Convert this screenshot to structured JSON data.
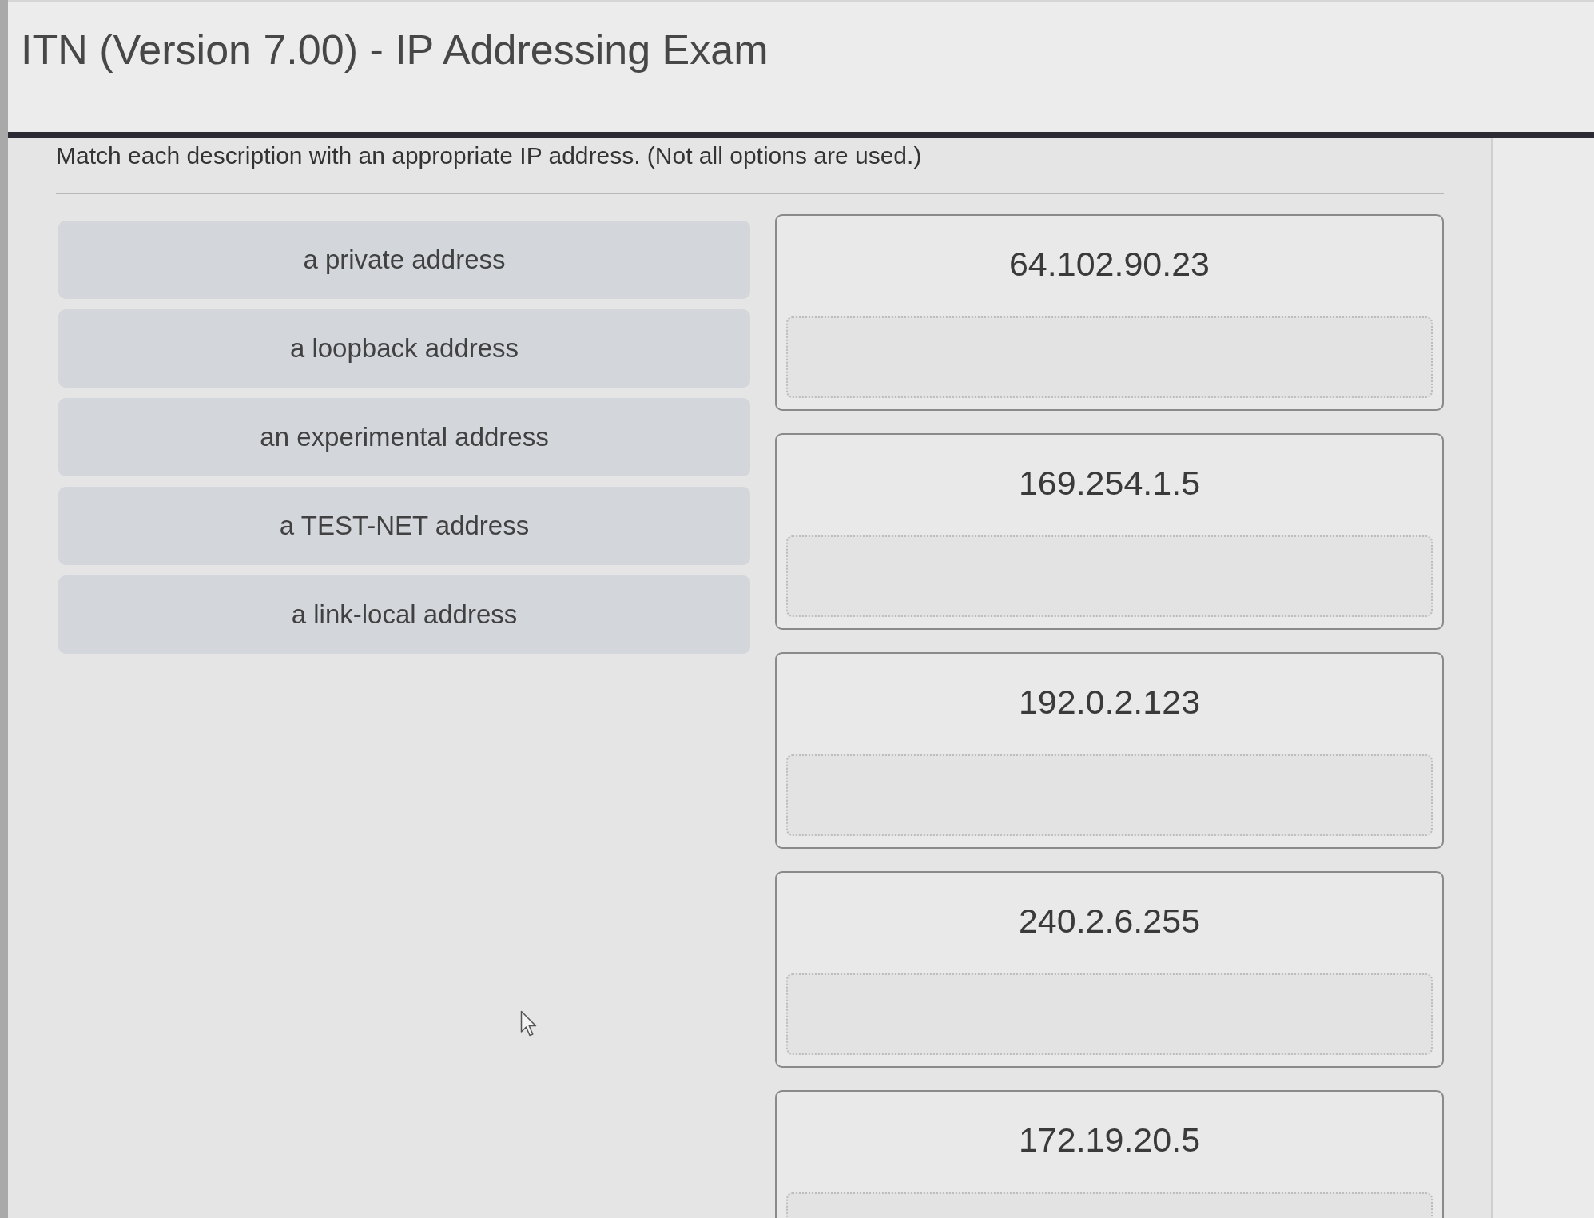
{
  "title": "ITN (Version 7.00) - IP Addressing Exam",
  "question": {
    "instruction": "Match each description with an appropriate IP address. (Not all options are used.)",
    "descriptions": [
      "a private address",
      "a loopback address",
      "an experimental address",
      "a TEST-NET address",
      "a link-local address"
    ],
    "addresses": [
      "64.102.90.23",
      "169.254.1.5",
      "192.0.2.123",
      "240.2.6.255",
      "172.19.20.5"
    ]
  }
}
